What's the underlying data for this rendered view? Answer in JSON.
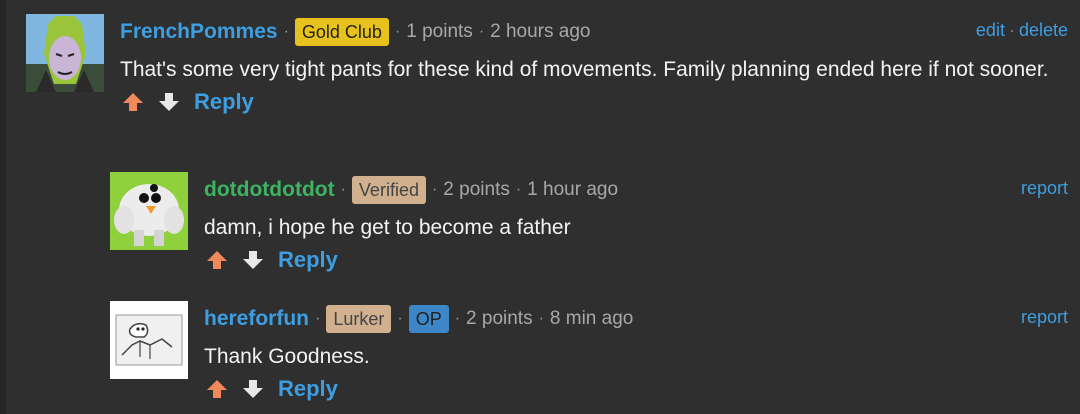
{
  "colors": {
    "background": "#2f2f2f",
    "link_blue": "#3d9ee2",
    "username_green": "#3cb462",
    "upvote_orange": "#f08a5d",
    "downvote_white": "#e8e8e8",
    "badge_gold": "#e8c21c",
    "badge_tan": "#d1b090",
    "badge_op": "#3d86c8"
  },
  "comments": [
    {
      "username": "FrenchPommes",
      "badges": [
        "Gold Club"
      ],
      "points": "1 points",
      "time": "2 hours ago",
      "actions": [
        "edit",
        "delete"
      ],
      "text": "That's some very tight pants for these kind of movements. Family planning ended here if not sooner.",
      "reply_label": "Reply",
      "upvote_icon": "arrow-up-icon",
      "downvote_icon": "arrow-down-icon"
    },
    {
      "username": "dotdotdotdot",
      "badges": [
        "Verified"
      ],
      "points": "2 points",
      "time": "1 hour ago",
      "actions": [
        "report"
      ],
      "text": "damn, i hope he get to become a father",
      "reply_label": "Reply",
      "upvote_icon": "arrow-up-icon",
      "downvote_icon": "arrow-down-icon"
    },
    {
      "username": "hereforfun",
      "badges": [
        "Lurker",
        "OP"
      ],
      "points": "2 points",
      "time": "8 min ago",
      "actions": [
        "report"
      ],
      "text": "Thank Goodness.",
      "reply_label": "Reply",
      "upvote_icon": "arrow-up-icon",
      "downvote_icon": "arrow-down-icon"
    }
  ]
}
